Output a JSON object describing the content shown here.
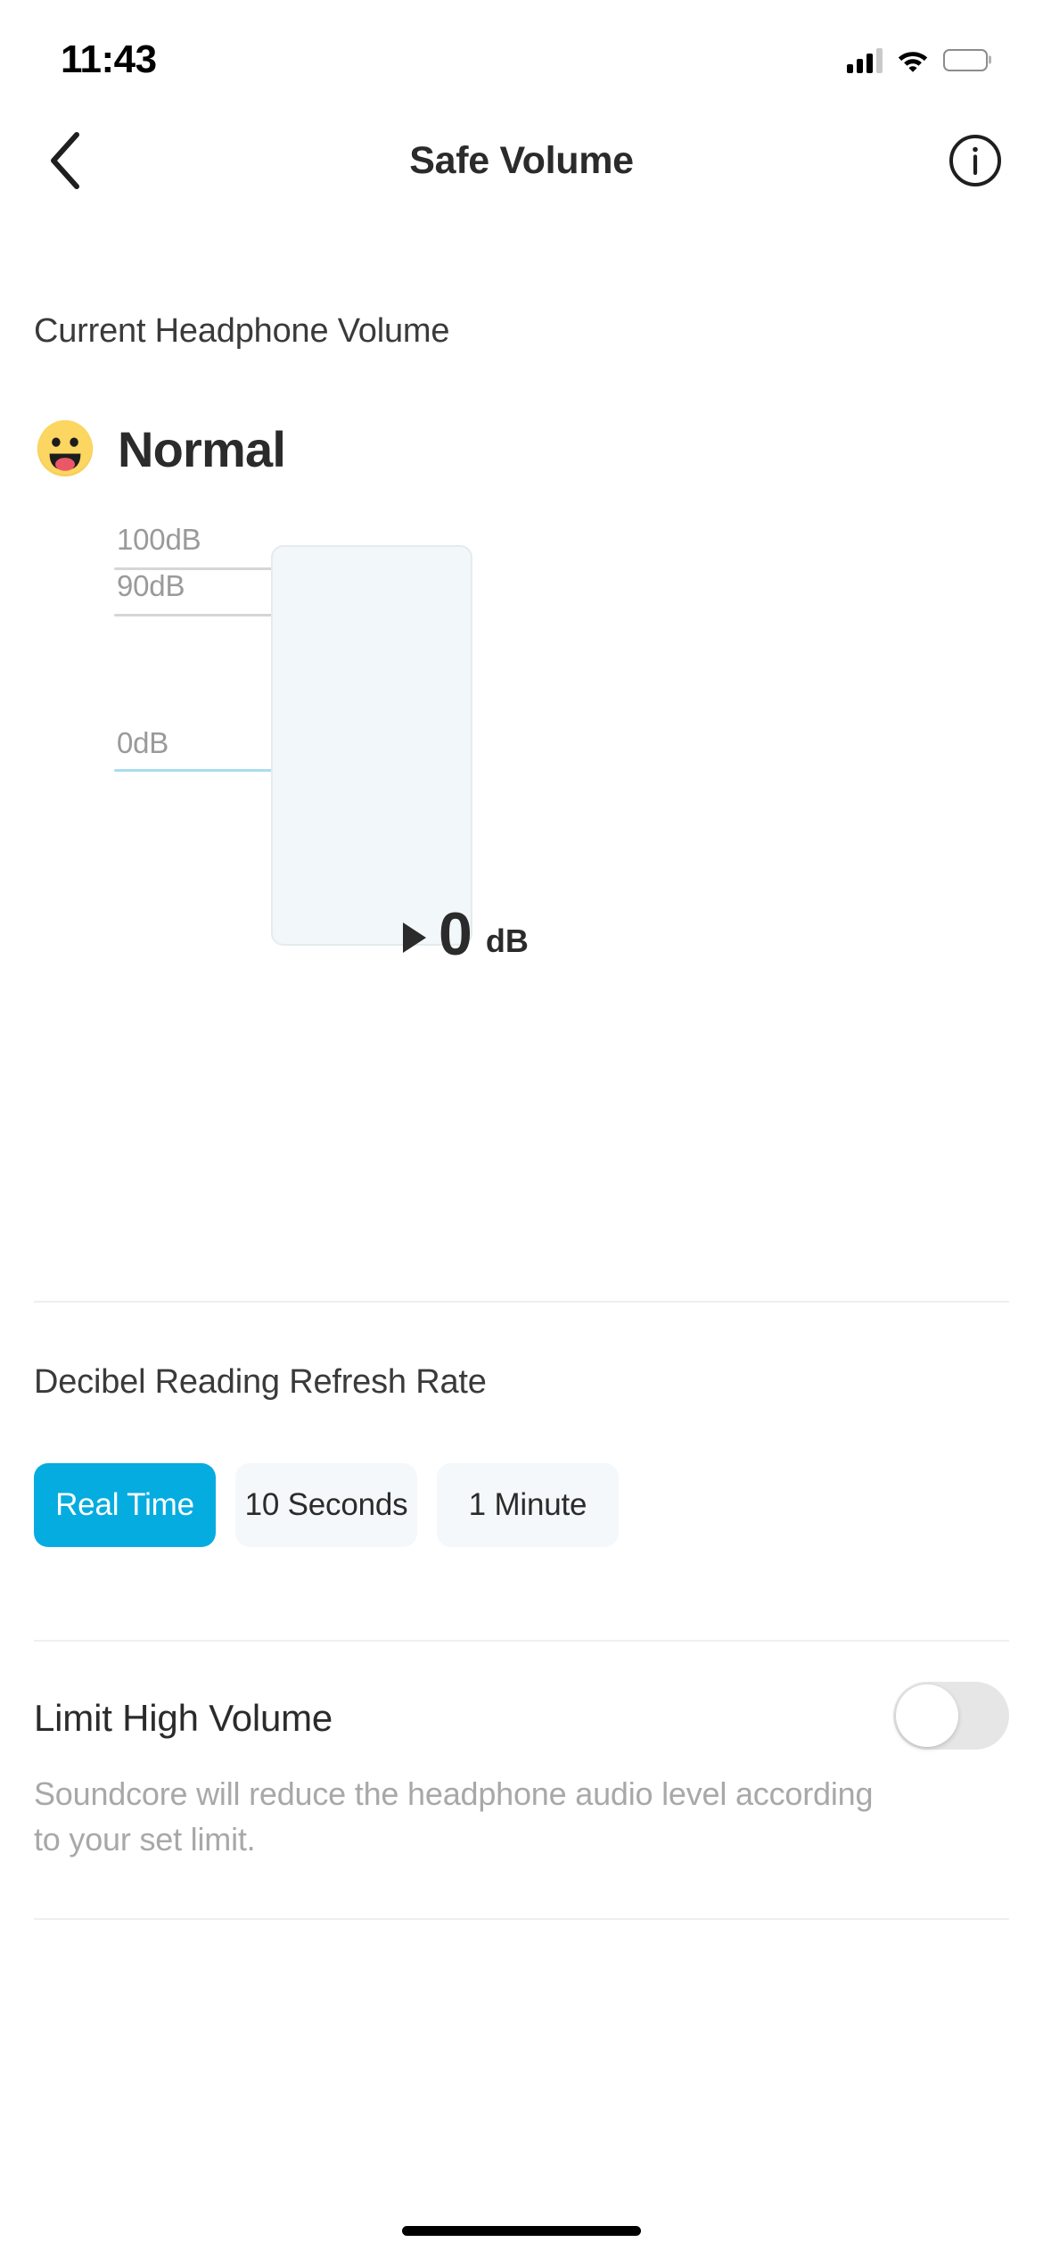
{
  "status_bar": {
    "time": "11:43",
    "cellular_icon": "cellular-signal-icon",
    "wifi_icon": "wifi-icon",
    "battery_icon": "battery-icon",
    "battery_fill_percent": 55
  },
  "nav": {
    "back_icon": "chevron-left-icon",
    "title": "Safe Volume",
    "info_icon": "info-circle-icon"
  },
  "current_volume": {
    "label": "Current Headphone Volume",
    "status_emoji": "grinning-face-emoji",
    "status_text": "Normal"
  },
  "chart_data": {
    "type": "bar",
    "title": "Current Headphone Volume",
    "categories": [
      "Headphone Volume"
    ],
    "values": [
      0
    ],
    "ylabel": "dB",
    "ylim": [
      0,
      100
    ],
    "tick_labels": [
      "100dB",
      "90dB",
      "0dB"
    ],
    "tick_values": [
      100,
      90,
      0
    ],
    "minor_tick_count": 27,
    "grid": true,
    "legend": "none",
    "readout_value": "0",
    "readout_unit": "dB",
    "readout_caret_icon": "play-triangle-icon",
    "accent_color": "#05ace0",
    "bar_track_color": "#f2f7f9",
    "baseline_color": "#a9dcf0"
  },
  "refresh_rate": {
    "label": "Decibel Reading Refresh Rate",
    "options": [
      {
        "label": "Real Time",
        "selected": true
      },
      {
        "label": "10 Seconds",
        "selected": false
      },
      {
        "label": "1 Minute",
        "selected": false
      }
    ]
  },
  "limit_high_volume": {
    "label": "Limit High Volume",
    "toggle_state": "off",
    "description": "Soundcore will reduce the headphone audio level according to your set limit."
  },
  "home_indicator": "home-indicator"
}
